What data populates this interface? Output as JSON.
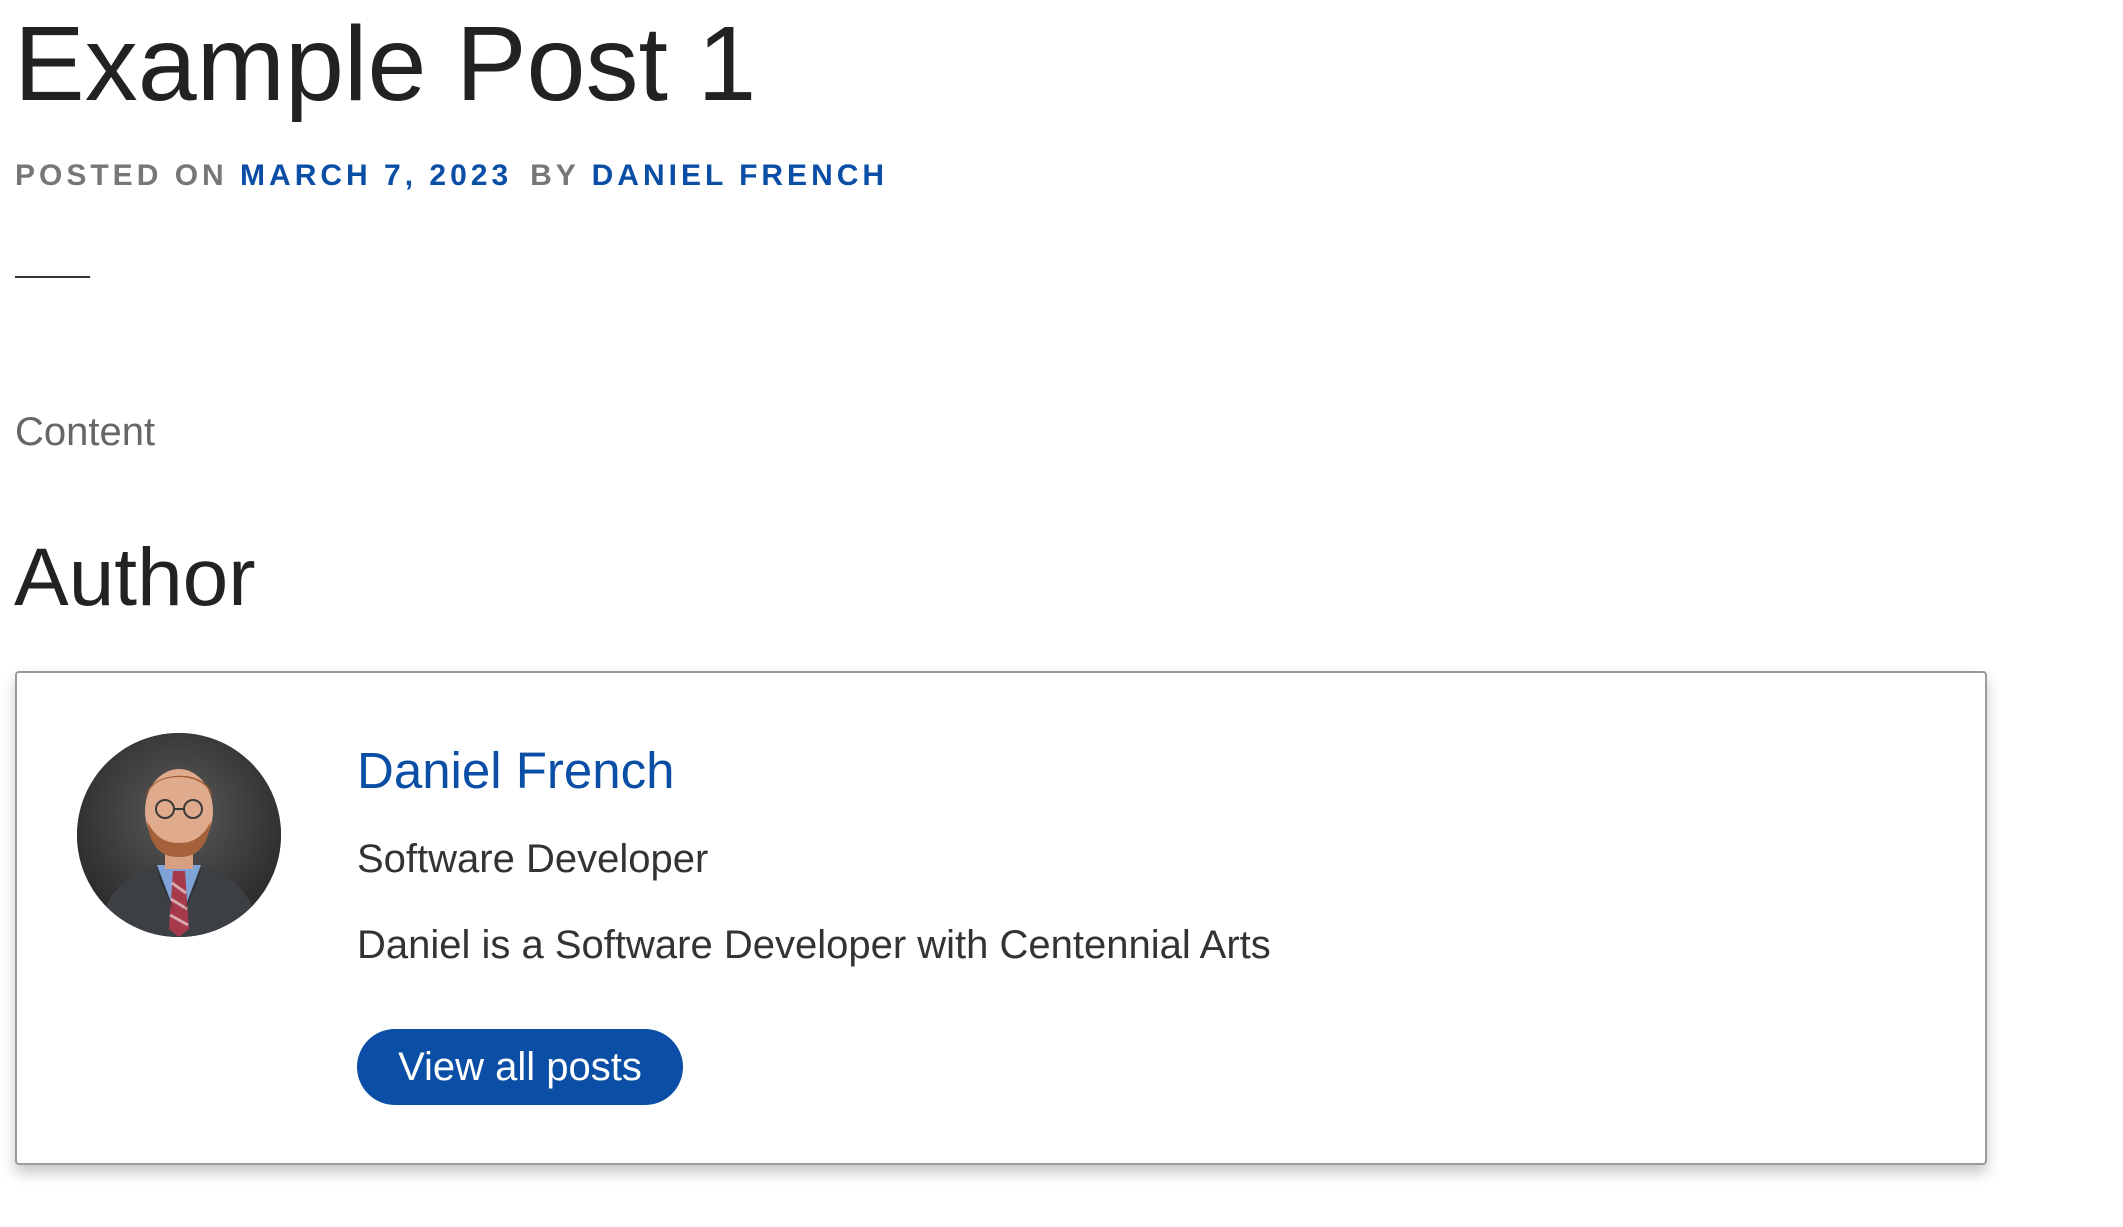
{
  "post": {
    "title": "Example Post 1",
    "meta": {
      "posted_on_label": "POSTED ON",
      "date": "MARCH 7, 2023",
      "by_label": "BY",
      "author": "DANIEL FRENCH"
    },
    "content": "Content"
  },
  "author_section": {
    "heading": "Author",
    "card": {
      "avatar_icon": "author-avatar-photo",
      "name": "Daniel French",
      "role": "Software Developer",
      "bio": "Daniel is a Software Developer with Centennial Arts",
      "button_label": "View all posts"
    }
  },
  "colors": {
    "link": "#0a4ea5",
    "button": "#0a4ea5",
    "muted": "#777777",
    "heading": "#222222"
  }
}
